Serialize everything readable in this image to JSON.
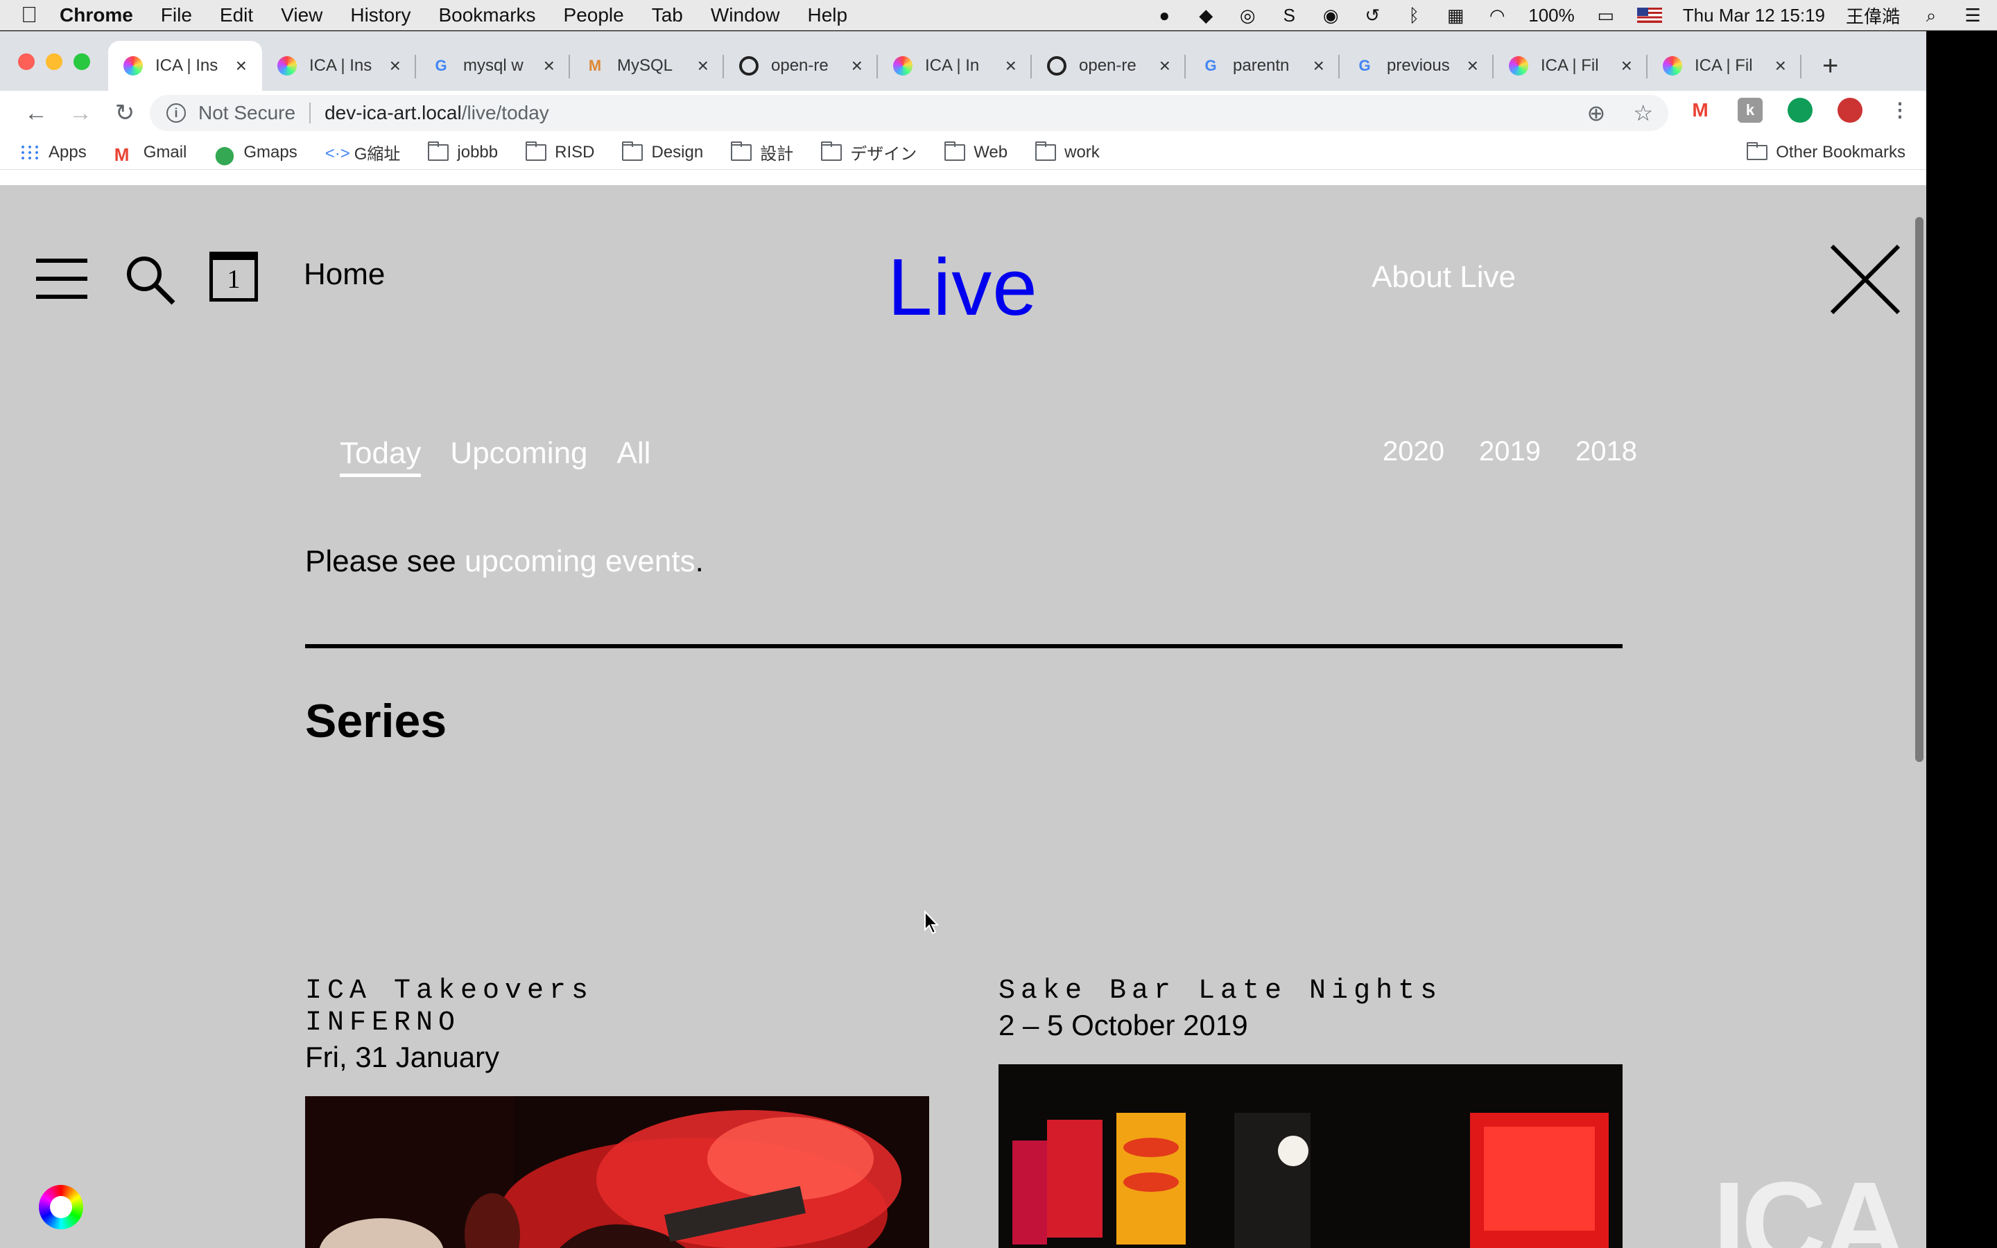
{
  "menubar": {
    "app": "Chrome",
    "items": [
      "File",
      "Edit",
      "View",
      "History",
      "Bookmarks",
      "People",
      "Tab",
      "Window",
      "Help"
    ],
    "battery": "100%",
    "clock": "Thu Mar 12  15:19",
    "user": "王偉澔"
  },
  "tabs": [
    {
      "title": "ICA | Ins",
      "icon": "ica-icon",
      "active": true
    },
    {
      "title": "ICA | Ins",
      "icon": "ica-icon"
    },
    {
      "title": "mysql w",
      "icon": "google-icon"
    },
    {
      "title": "MySQL",
      "icon": "mysql-icon"
    },
    {
      "title": "open-re",
      "icon": "github-icon"
    },
    {
      "title": "ICA | In",
      "icon": "ica-icon"
    },
    {
      "title": "open-re",
      "icon": "github-icon"
    },
    {
      "title": "parentn",
      "icon": "google-icon"
    },
    {
      "title": "previous",
      "icon": "google-icon"
    },
    {
      "title": "ICA | Fil",
      "icon": "ica-icon"
    },
    {
      "title": "ICA | Fil",
      "icon": "ica-icon"
    }
  ],
  "omnibox": {
    "security": "Not Secure",
    "host": "dev-ica-art.local",
    "path": "/live/today"
  },
  "bookmarks": {
    "items": [
      "Apps",
      "Gmail",
      "Gmaps",
      "G縮址",
      "jobbb",
      "RISD",
      "Design",
      "設計",
      "デザイン",
      "Web",
      "work"
    ],
    "other": "Other Bookmarks"
  },
  "page": {
    "home": "Home",
    "title": "Live",
    "about": "About Live",
    "calendar_day": "1",
    "filters": [
      "Today",
      "Upcoming",
      "All"
    ],
    "years": [
      "2020",
      "2019",
      "2018"
    ],
    "notice_prefix": "Please see ",
    "notice_link": "upcoming events",
    "notice_suffix": ".",
    "series_heading": "Series",
    "cards": [
      {
        "title_line1": "ICA Takeovers",
        "title_line2": "INFERNO",
        "date": "Fri, 31 January"
      },
      {
        "title_line1": "Sake Bar Late Nights",
        "date": "2 – 5 October 2019"
      }
    ],
    "logo": "ICA"
  }
}
